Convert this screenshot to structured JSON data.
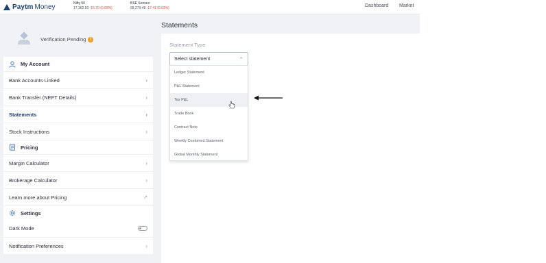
{
  "topbar": {
    "logo_brand": "Paytm",
    "logo_product": "Money",
    "tickers": [
      {
        "name": "Nifty 50",
        "value": "17,362.50",
        "change": "-15.70 (0.09%)"
      },
      {
        "name": "BSE Sensex",
        "value": "58,279.48",
        "change": "-17.41 (0.03%)"
      }
    ],
    "nav": {
      "dashboard": "Dashboard",
      "market": "Market"
    }
  },
  "profile": {
    "status": "Verification Pending",
    "status_badge": "!"
  },
  "sidebar": {
    "account": {
      "heading": "My Account",
      "items": [
        {
          "label": "Bank Accounts Linked"
        },
        {
          "label": "Bank Transfer (NEFT Details)"
        },
        {
          "label": "Statements"
        },
        {
          "label": "Stock Instructions"
        }
      ]
    },
    "pricing": {
      "heading": "Pricing",
      "items": [
        {
          "label": "Margin Calculator"
        },
        {
          "label": "Brokerage Calculator"
        },
        {
          "label": "Learn more about Pricing"
        }
      ]
    },
    "settings": {
      "heading": "Settings",
      "items": [
        {
          "label": "Dark Mode",
          "toggle": false
        },
        {
          "label": "Notification Preferences"
        }
      ]
    }
  },
  "main": {
    "title": "Statements",
    "statement_type_label": "Statement Type",
    "select_placeholder": "Select statement",
    "options": [
      "Ledger Statement",
      "P&L Statement",
      "Tax P&L",
      "Trade Book",
      "Contract Note",
      "Weekly Combined Statement",
      "Global Monthly Statement"
    ],
    "hovered_option": "Tax P&L"
  },
  "icons": {
    "chevron": "›",
    "external": "↗",
    "caret": "⌃"
  },
  "colors": {
    "brand": "#1c3f6e",
    "negative": "#e0463c",
    "warning": "#f0a01e"
  }
}
